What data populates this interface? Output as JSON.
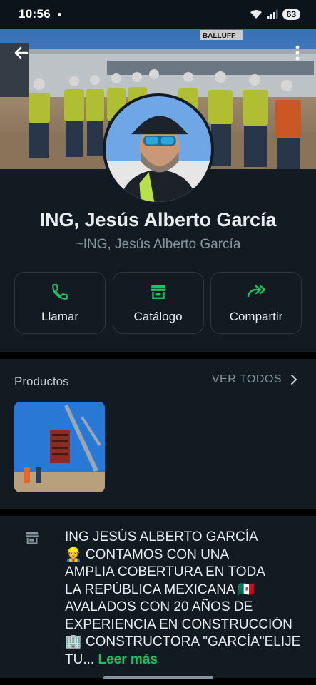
{
  "status_bar": {
    "time": "10:56",
    "battery": "63"
  },
  "cover": {
    "building_sign": "BALLUFF"
  },
  "profile": {
    "name": "ING, Jesús Alberto García",
    "push_name": "~ING, Jesús Alberto García"
  },
  "actions": [
    {
      "label": "Llamar",
      "icon": "phone-icon"
    },
    {
      "label": "Catálogo",
      "icon": "storefront-icon"
    },
    {
      "label": "Compartir",
      "icon": "share-forward-icon"
    }
  ],
  "products": {
    "title": "Productos",
    "see_all": "VER TODOS"
  },
  "description": {
    "lines": [
      "ING JESÚS ALBERTO GARCÍA",
      "👷 CONTAMOS CON UNA",
      "AMPLIA COBERTURA EN TODA",
      "LA REPÚBLICA MEXICANA 🇲🇽",
      "AVALADOS CON 20 AÑOS DE",
      "EXPERIENCIA EN CONSTRUCCIÓN",
      "🏢 CONSTRUCTORA \"GARCÍA\"ELIJE",
      "TU..."
    ],
    "read_more": "Leer más"
  },
  "colors": {
    "accent": "#21c063",
    "background": "#111b21",
    "muted": "#8696a0"
  }
}
